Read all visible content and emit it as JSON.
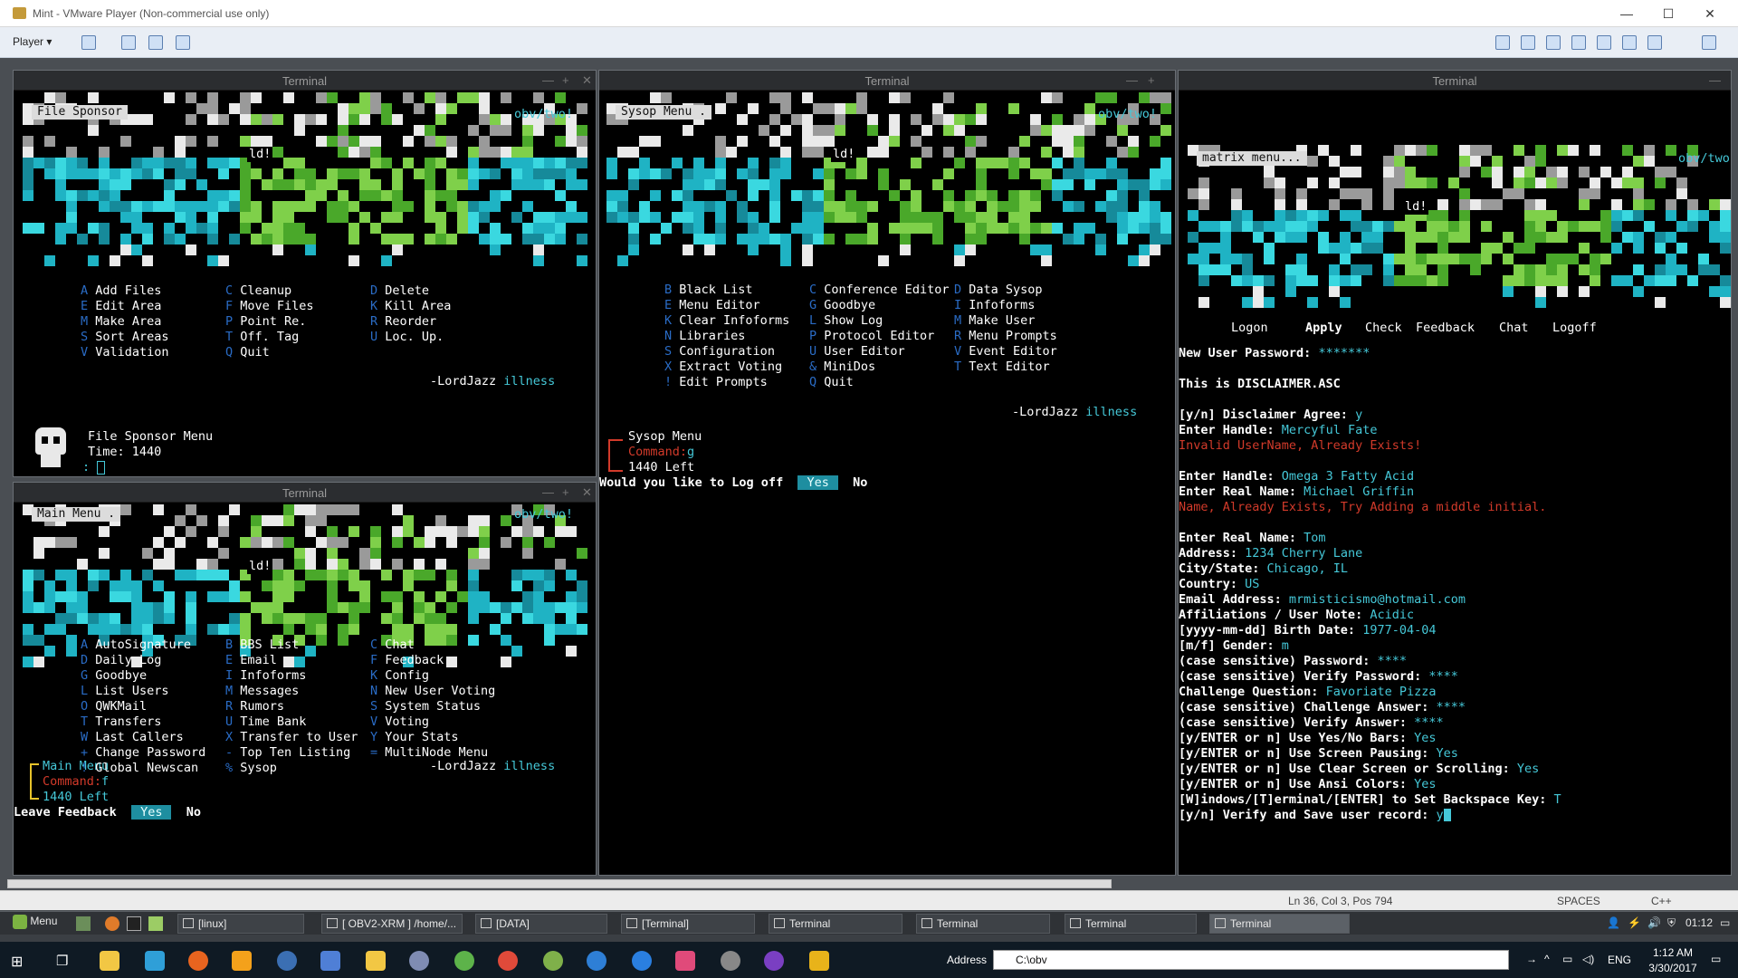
{
  "vm": {
    "title": "Mint - VMware Player (Non-commercial use only)",
    "player_menu": "Player",
    "min": "—",
    "max": "☐",
    "close": "✕"
  },
  "terminal_title": "Terminal",
  "art": {
    "tag": "obv/two!",
    "ld": "ld!",
    "word": "TWO"
  },
  "t1": {
    "label": "File Sponsor",
    "cols": [
      [
        [
          "A",
          "Add Files"
        ],
        [
          "E",
          "Edit Area"
        ],
        [
          "M",
          "Make Area"
        ],
        [
          "S",
          "Sort Areas"
        ],
        [
          "V",
          "Validation"
        ]
      ],
      [
        [
          "C",
          "Cleanup"
        ],
        [
          "F",
          "Move Files"
        ],
        [
          "P",
          "Point Re."
        ],
        [
          "T",
          "Off. Tag"
        ],
        [
          "Q",
          "Quit"
        ]
      ],
      [
        [
          "D",
          "Delete"
        ],
        [
          "K",
          "Kill Area"
        ],
        [
          "R",
          "Reorder"
        ],
        [
          "U",
          "Loc. Up."
        ]
      ]
    ],
    "credit": "-LordJazz",
    "credit2": "illness",
    "prompt1": "File Sponsor Menu",
    "prompt2": "Time: 1440",
    "prompt3": ":"
  },
  "t2": {
    "label": "Sysop Menu .",
    "cols": [
      [
        [
          "B",
          "Black List"
        ],
        [
          "E",
          "Menu Editor"
        ],
        [
          "K",
          "Clear Infoforms"
        ],
        [
          "N",
          "Libraries"
        ],
        [
          "S",
          "Configuration"
        ],
        [
          "X",
          "Extract Voting"
        ],
        [
          "!",
          "Edit Prompts"
        ]
      ],
      [
        [
          "C",
          "Conference Editor"
        ],
        [
          "G",
          "Goodbye"
        ],
        [
          "L",
          "Show Log"
        ],
        [
          "P",
          "Protocol Editor"
        ],
        [
          "U",
          "User Editor"
        ],
        [
          "&",
          "MiniDos"
        ],
        [
          "Q",
          "Quit"
        ]
      ],
      [
        [
          "D",
          "Data Sysop"
        ],
        [
          "I",
          "Infoforms"
        ],
        [
          "M",
          "Make User"
        ],
        [
          "R",
          "Menu Prompts"
        ],
        [
          "V",
          "Event Editor"
        ],
        [
          "T",
          "Text Editor"
        ]
      ]
    ],
    "credit": "-LordJazz",
    "credit2": "illness",
    "prompt1": "Sysop Menu",
    "prompt2": "Command:",
    "prompt2val": "g",
    "prompt3": "1440 Left",
    "logoff_q": "Would you like to Log off",
    "yes": "Yes",
    "no": "No"
  },
  "t3": {
    "label": "Main Menu  .",
    "cols": [
      [
        [
          "A",
          "AutoSignature"
        ],
        [
          "D",
          "Daily Log"
        ],
        [
          "G",
          "Goodbye"
        ],
        [
          "L",
          "List Users"
        ],
        [
          "O",
          "QWKMail"
        ],
        [
          "T",
          "Transfers"
        ],
        [
          "W",
          "Last Callers"
        ],
        [
          "+",
          "Change Password"
        ],
        [
          "!",
          "Global Newscan"
        ]
      ],
      [
        [
          "B",
          "BBS List"
        ],
        [
          "E",
          "Email"
        ],
        [
          "I",
          "Infoforms"
        ],
        [
          "M",
          "Messages"
        ],
        [
          "R",
          "Rumors"
        ],
        [
          "U",
          "Time Bank"
        ],
        [
          "X",
          "Transfer to User"
        ],
        [
          "-",
          "Top Ten Listing"
        ],
        [
          "%",
          "Sysop"
        ]
      ],
      [
        [
          "C",
          "Chat"
        ],
        [
          "F",
          "Feedback"
        ],
        [
          "K",
          "Config"
        ],
        [
          "N",
          "New User Voting"
        ],
        [
          "S",
          "System Status"
        ],
        [
          "V",
          "Voting"
        ],
        [
          "Y",
          "Your Stats"
        ],
        [
          "=",
          "MultiNode Menu"
        ]
      ]
    ],
    "credit": "-LordJazz",
    "credit2": "illness",
    "prompt1": "Main Menu",
    "prompt2": "Command:",
    "prompt2val": "f",
    "prompt3": "1440 Left",
    "feedback_q": "Leave Feedback",
    "yes": "Yes",
    "no": "No"
  },
  "t4": {
    "label": "matrix menu...",
    "nav": [
      "Logon",
      "Apply",
      "Check",
      "Feedback",
      "Chat",
      "Logoff"
    ],
    "lines": [
      [
        [
          "New User Password: ",
          "bold"
        ],
        [
          "*******",
          "cyan"
        ]
      ],
      [],
      [
        [
          "This is DISCLAIMER.ASC",
          "bold"
        ]
      ],
      [],
      [
        [
          "[y/n] Disclaimer Agree: ",
          "bold"
        ],
        [
          "y",
          "cyan"
        ]
      ],
      [
        [
          "Enter Handle: ",
          "bold"
        ],
        [
          "Mercyful Fate",
          "cyan"
        ]
      ],
      [
        [
          "Invalid UserName, Already Exists!",
          "red"
        ]
      ],
      [],
      [
        [
          "Enter Handle: ",
          "bold"
        ],
        [
          "Omega 3 Fatty Acid",
          "cyan"
        ]
      ],
      [
        [
          "Enter Real Name: ",
          "bold"
        ],
        [
          "Michael Griffin",
          "cyan"
        ]
      ],
      [
        [
          "Name, Already Exists, Try Adding a middle initial.",
          "red"
        ]
      ],
      [],
      [
        [
          "Enter Real Name: ",
          "bold"
        ],
        [
          "Tom",
          "cyan"
        ]
      ],
      [
        [
          "Address: ",
          "bold"
        ],
        [
          "1234 Cherry Lane",
          "cyan"
        ]
      ],
      [
        [
          "City/State: ",
          "bold"
        ],
        [
          "Chicago, IL",
          "cyan"
        ]
      ],
      [
        [
          "Country: ",
          "bold"
        ],
        [
          "US",
          "cyan"
        ]
      ],
      [
        [
          "Email Address: ",
          "bold"
        ],
        [
          "mrmisticismo@hotmail.com",
          "cyan"
        ]
      ],
      [
        [
          "Affiliations / User Note: ",
          "bold"
        ],
        [
          "Acidic",
          "cyan"
        ]
      ],
      [
        [
          "[yyyy-mm-dd] Birth Date: ",
          "bold"
        ],
        [
          "1977-04-04",
          "cyan"
        ]
      ],
      [
        [
          "[m/f] Gender: ",
          "bold"
        ],
        [
          "m",
          "cyan"
        ]
      ],
      [
        [
          "(case sensitive) Password: ",
          "bold"
        ],
        [
          "****",
          "cyan"
        ]
      ],
      [
        [
          "(case sensitive) Verify Password: ",
          "bold"
        ],
        [
          "****",
          "cyan"
        ]
      ],
      [
        [
          "Challenge Question: ",
          "bold"
        ],
        [
          "Favoriate Pizza",
          "cyan"
        ]
      ],
      [
        [
          "(case sensitive) Challenge Answer: ",
          "bold"
        ],
        [
          "****",
          "cyan"
        ]
      ],
      [
        [
          "(case sensitive) Verify Answer: ",
          "bold"
        ],
        [
          "****",
          "cyan"
        ]
      ],
      [
        [
          "[y/ENTER or n] Use Yes/No Bars: ",
          "bold"
        ],
        [
          "Yes",
          "cyan"
        ]
      ],
      [
        [
          "[y/ENTER or n] Use Screen Pausing: ",
          "bold"
        ],
        [
          "Yes",
          "cyan"
        ]
      ],
      [
        [
          "[y/ENTER or n] Use Clear Screen or Scrolling: ",
          "bold"
        ],
        [
          "Yes",
          "cyan"
        ]
      ],
      [
        [
          "[y/ENTER or n] Use Ansi Colors: ",
          "bold"
        ],
        [
          "Yes",
          "cyan"
        ]
      ],
      [
        [
          "[W]indows/[T]erminal/[ENTER] to Set Backspace Key: ",
          "bold"
        ],
        [
          "T",
          "cyan"
        ]
      ],
      [
        [
          "[y/n] Verify and Save user record: ",
          "bold"
        ],
        [
          "y",
          "cyan"
        ]
      ]
    ]
  },
  "status": {
    "pos": "Ln 36, Col 3, Pos 794",
    "spaces": "SPACES",
    "lang": "C++"
  },
  "mint": {
    "menu": "Menu",
    "tasks": [
      "[linux]",
      "[ OBV2-XRM ] /home/...",
      "[DATA]",
      "[Terminal]",
      "Terminal",
      "Terminal",
      "Terminal",
      "Terminal"
    ],
    "clock": "01:12"
  },
  "win": {
    "address_label": "Address",
    "address_value": "C:\\obv",
    "lang": "ENG",
    "time": "1:12 AM",
    "date": "3/30/2017"
  }
}
